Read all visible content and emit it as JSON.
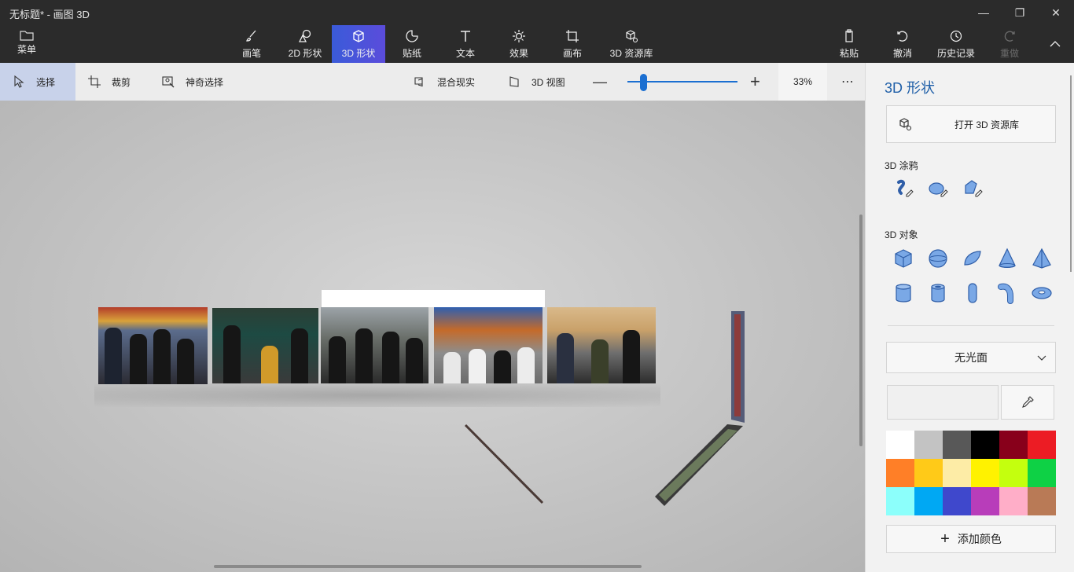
{
  "window": {
    "title": "无标题* - 画图 3D"
  },
  "menu": {
    "label": "菜单",
    "icon": "folder-icon"
  },
  "toolbar": {
    "tools": [
      {
        "label": "画笔",
        "icon": "brush-icon"
      },
      {
        "label": "2D 形状",
        "icon": "2d-shapes-icon"
      },
      {
        "label": "3D 形状",
        "icon": "3d-shapes-icon",
        "active": true
      },
      {
        "label": "贴纸",
        "icon": "sticker-icon"
      },
      {
        "label": "文本",
        "icon": "text-icon"
      },
      {
        "label": "效果",
        "icon": "effects-icon"
      },
      {
        "label": "画布",
        "icon": "canvas-icon"
      },
      {
        "label": "3D 资源库",
        "icon": "3d-library-icon"
      }
    ],
    "right": [
      {
        "label": "粘贴",
        "icon": "paste-icon"
      },
      {
        "label": "撤消",
        "icon": "undo-icon"
      },
      {
        "label": "历史记录",
        "icon": "history-icon"
      },
      {
        "label": "重做",
        "icon": "redo-icon",
        "disabled": true
      }
    ]
  },
  "subbar": {
    "select": "选择",
    "crop": "裁剪",
    "magic_select": "神奇选择",
    "mixed_reality": "混合现实",
    "view_3d": "3D 视图",
    "zoom": "33%",
    "zoom_level": 0.14
  },
  "panel": {
    "title": "3D 形状",
    "open_library": "打开 3D 资源库",
    "doodle_heading": "3D 涂鸦",
    "objects_heading": "3D 对象",
    "material": "无光面",
    "add_color": "添加颜色",
    "palette": [
      "#ffffff",
      "#c3c3c3",
      "#585858",
      "#000000",
      "#88001b",
      "#ec1c24",
      "#ff7f27",
      "#ffca18",
      "#fdeca6",
      "#fff200",
      "#c4ff0e",
      "#0ed145",
      "#8cfffb",
      "#00a8f3",
      "#3f48cc",
      "#b83dba",
      "#ffaec8",
      "#b97a56"
    ]
  },
  "accent": "#1b6fd1"
}
